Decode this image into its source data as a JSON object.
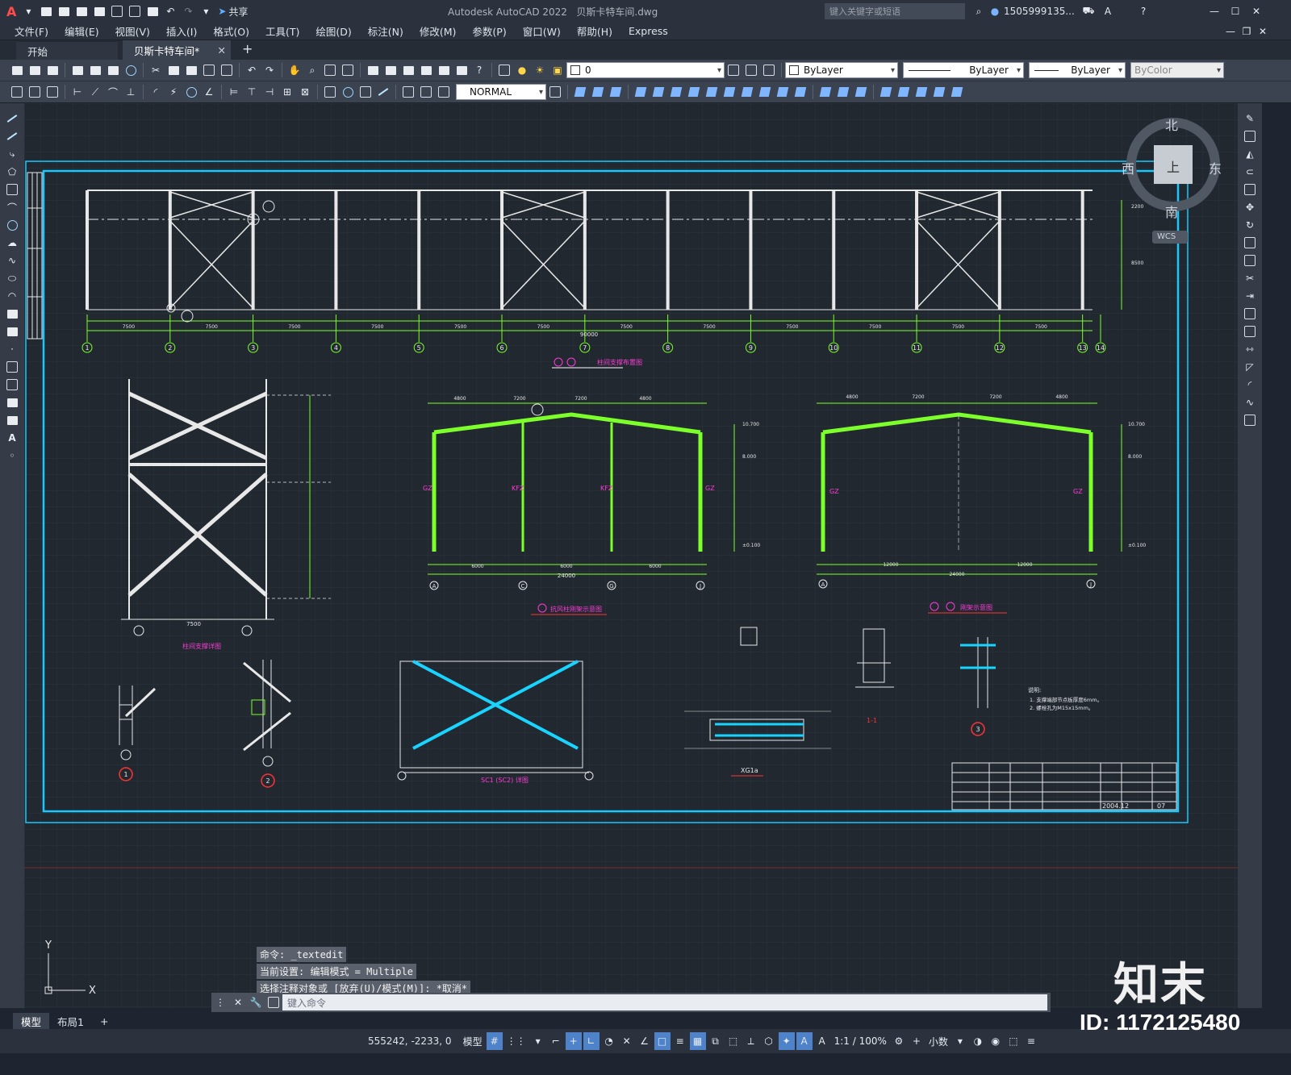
{
  "title_bar": {
    "app_title": "Autodesk AutoCAD 2022",
    "file_name": "贝斯卡特车间.dwg",
    "share_label": "共享",
    "search_placeholder": "键入关键字或短语",
    "user_name": "1505999135...",
    "logo_letter": "A"
  },
  "menu": [
    "文件(F)",
    "编辑(E)",
    "视图(V)",
    "插入(I)",
    "格式(O)",
    "工具(T)",
    "绘图(D)",
    "标注(N)",
    "修改(M)",
    "参数(P)",
    "窗口(W)",
    "帮助(H)",
    "Express"
  ],
  "doc_tabs": [
    {
      "label": "开始",
      "active": false
    },
    {
      "label": "贝斯卡特车间*",
      "active": true
    }
  ],
  "toolbar": {
    "layer_value": "0",
    "color_value": "ByLayer",
    "linetype_value": "ByLayer",
    "lineweight_value": "ByLayer",
    "plotstyle_value": "ByColor",
    "dimstyle_value": "NORMAL"
  },
  "viewcube": {
    "north": "北",
    "south": "南",
    "east": "东",
    "west": "西",
    "top": "上",
    "wcs": "WCS"
  },
  "drawing": {
    "elevation_title": "柱间支撑布置图",
    "frame1_title": "抗风柱刚架示意图",
    "frame2_title": "刚架示意图",
    "bracing_title": "柱间支撑详图",
    "sc_title": "SC1 (SC2) 详图",
    "xg_title": "XG1a",
    "section_label": "1-1",
    "col_axis_labels": [
      "1",
      "2",
      "3",
      "4",
      "5",
      "6",
      "7",
      "8",
      "9",
      "10",
      "11",
      "12",
      "13",
      "14"
    ],
    "bay_spacing": "7500",
    "total_length": "90000",
    "frame_span": "24000",
    "span_labels_frame1": [
      "6000",
      "6000",
      "6000",
      "6000"
    ],
    "span_labels_frame2": [
      "12000",
      "12000"
    ],
    "frame_top_dims": [
      "4800",
      "7200",
      "7200",
      "4800"
    ],
    "frame_labels": [
      "GZ",
      "KFZ",
      "KFZ",
      "GZ"
    ],
    "frame_axis1": [
      "A",
      "C",
      "G",
      "J"
    ],
    "frame_axis2": [
      "A",
      "J"
    ],
    "detail_nums": [
      "1",
      "2",
      "3"
    ],
    "notes_title": "说明:",
    "notes": [
      "1. 支撑端部节点板厚度6mm。",
      "2. 螺栓孔为M15x15mm。"
    ],
    "titleblock_date": "2004.12",
    "titleblock_sheet": "07"
  },
  "command_history": [
    "命令: _textedit",
    "当前设置: 编辑模式 = Multiple",
    "选择注释对象或 [放弃(U)/模式(M)]: *取消*"
  ],
  "command_placeholder": "键入命令",
  "layout_tabs": [
    {
      "label": "模型",
      "active": true
    },
    {
      "label": "布局1",
      "active": false
    }
  ],
  "status": {
    "coords": "555242, -2233, 0",
    "space": "模型",
    "scale": "1:1 / 100%",
    "units": "小数"
  },
  "watermark": {
    "logo": "知末",
    "id": "ID: 1172125480"
  },
  "colors": {
    "bg": "#212830",
    "frame": "#19c8ff",
    "member": "#7cff2a",
    "white": "#e8e8e8",
    "magenta": "#ff3bd6",
    "red": "#ff3333",
    "yellow": "#ffe14a"
  }
}
